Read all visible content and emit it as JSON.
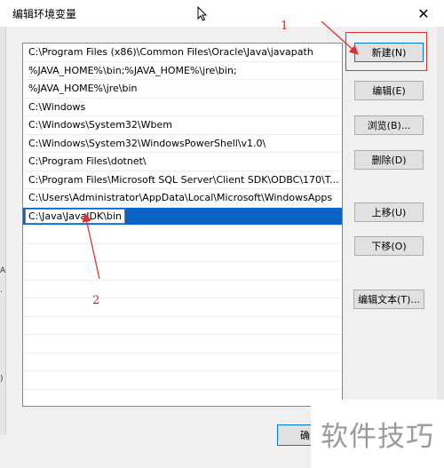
{
  "window": {
    "title": "编辑环境变量",
    "close_glyph": "✕"
  },
  "paths": [
    "C:\\Program Files (x86)\\Common Files\\Oracle\\Java\\javapath",
    "%JAVA_HOME%\\bin;%JAVA_HOME%\\jre\\bin;",
    "%JAVA_HOME%\\jre\\bin",
    "C:\\Windows",
    "C:\\Windows\\System32\\Wbem",
    "C:\\Windows\\System32\\WindowsPowerShell\\v1.0\\",
    "C:\\Program Files\\dotnet\\",
    "C:\\Program Files\\Microsoft SQL Server\\Client SDK\\ODBC\\170\\T...",
    "C:\\Users\\Administrator\\AppData\\Local\\Microsoft\\WindowsApps"
  ],
  "editing_value": "C:\\Java\\JavaJDK\\bin",
  "buttons": {
    "new": "新建(N)",
    "edit": "编辑(E)",
    "browse": "浏览(B)...",
    "delete": "删除(D)",
    "move_up": "上移(U)",
    "move_down": "下移(O)",
    "edit_text": "编辑文本(T)...",
    "ok_partial": "确"
  },
  "annotations": {
    "step1": "1",
    "step2": "2",
    "color": "#e03030"
  },
  "watermark": "软件技巧",
  "colors": {
    "selection": "#0a64c8",
    "primary_border": "#0078d7"
  }
}
